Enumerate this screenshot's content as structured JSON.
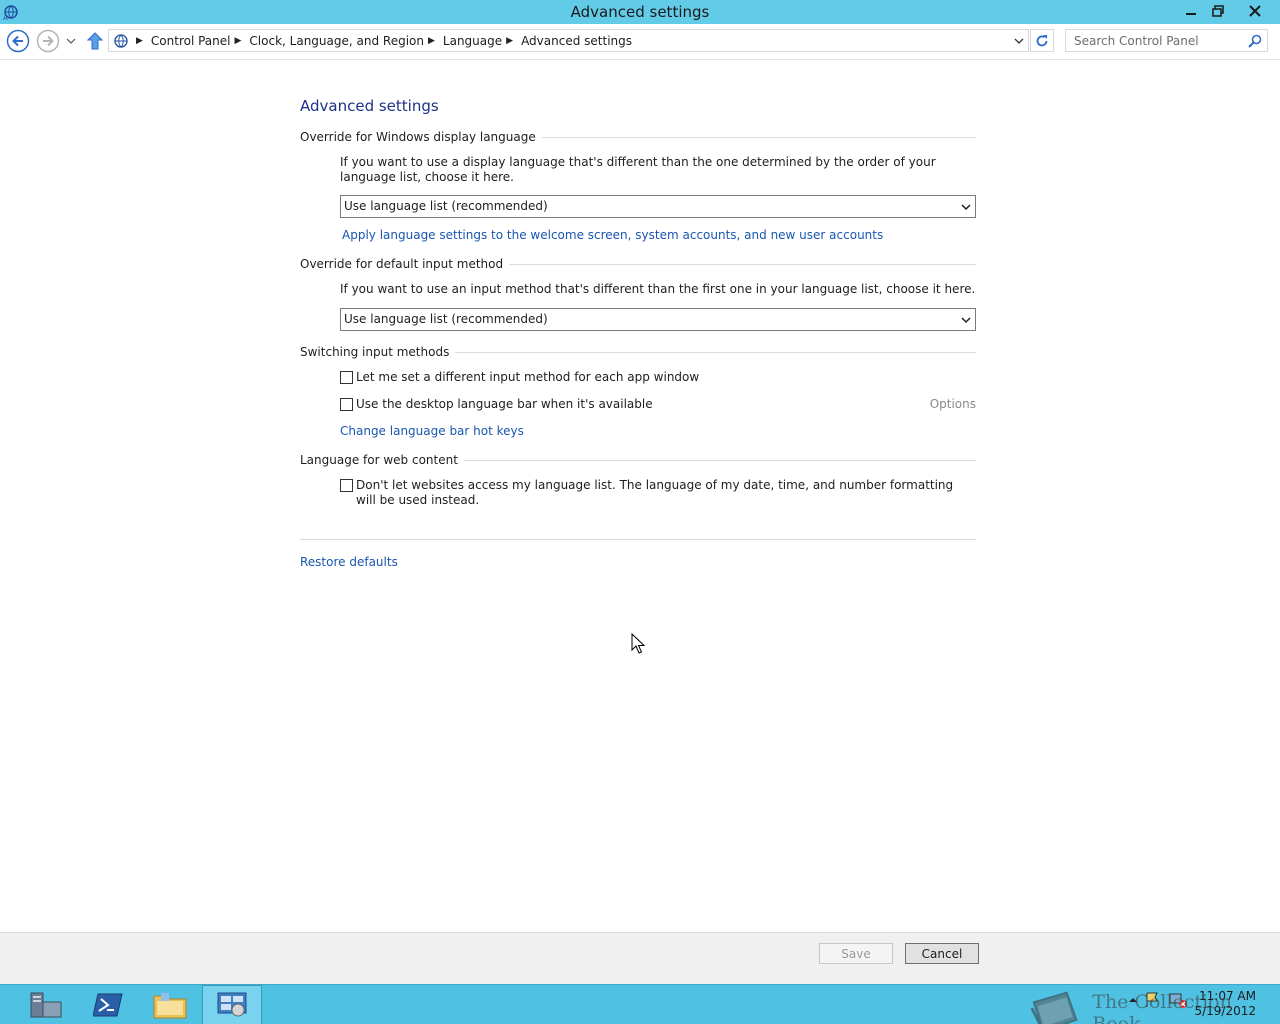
{
  "window": {
    "title": "Advanced settings"
  },
  "address_bar": {
    "breadcrumbs": [
      "Control Panel",
      "Clock, Language, and Region",
      "Language",
      "Advanced settings"
    ]
  },
  "search": {
    "placeholder": "Search Control Panel"
  },
  "content": {
    "title": "Advanced settings",
    "sections": {
      "display_language": {
        "heading": "Override for Windows display language",
        "description": "If you want to use a display language that's different than the one determined by the order of your language list, choose it here.",
        "select_value": "Use language list (recommended)",
        "link": "Apply language settings to the welcome screen, system accounts, and new user accounts"
      },
      "input_method": {
        "heading": "Override for default input method",
        "description": "If you want to use an input method that's different than the first one in your language list, choose it here.",
        "select_value": "Use language list (recommended)"
      },
      "switching": {
        "heading": "Switching input methods",
        "checkbox_per_app": "Let me set a different input method for each app window",
        "checkbox_language_bar": "Use the desktop language bar when it's available",
        "options_link": "Options",
        "hotkeys_link": "Change language bar hot keys"
      },
      "web_content": {
        "heading": "Language for web content",
        "checkbox_websites": "Don't let websites access my language list. The language of my date, time, and number formatting will be used instead."
      }
    },
    "restore_defaults": "Restore defaults"
  },
  "actions": {
    "save": "Save",
    "cancel": "Cancel"
  },
  "taskbar": {
    "time": "11:07 AM",
    "date": "5/19/2012"
  },
  "watermark": {
    "text": "The Collection Book"
  },
  "colors": {
    "titlebar": "#62cbe8",
    "taskbar": "#4fc1e3",
    "link": "#1a56b0",
    "heading": "#1e3287"
  }
}
